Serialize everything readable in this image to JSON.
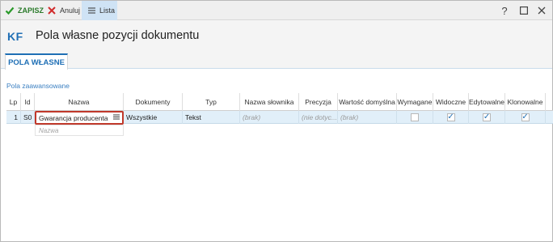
{
  "toolbar": {
    "save_label": "ZAPISZ",
    "cancel_label": "Anuluj",
    "list_label": "Lista",
    "save_icon": "checkmark-icon",
    "cancel_icon": "x-icon",
    "list_icon": "menu-icon"
  },
  "window_controls": {
    "help": "?",
    "maximize": "☐",
    "close": "✕"
  },
  "header": {
    "badge": "KF",
    "title": "Pola własne pozycji dokumentu"
  },
  "tabs": [
    {
      "label": "POLA WŁASNE",
      "active": true
    }
  ],
  "section": {
    "label": "Pola zaawansowane"
  },
  "grid": {
    "columns": [
      "Lp",
      "Id",
      "Nazwa",
      "Dokumenty",
      "Typ",
      "Nazwa słownika",
      "Precyzja",
      "Wartość domyślna",
      "Wymagane",
      "Widoczne",
      "Edytowalne",
      "Klonowalne"
    ],
    "rows": [
      {
        "lp": "1",
        "id": "S0",
        "nazwa": "Gwarancja producenta",
        "dokumenty": "Wszystkie",
        "typ": "Tekst",
        "nazwa_slownika": "(brak)",
        "precyzja": "(nie dotyc...",
        "wartosc_domyslna": "(brak)",
        "wymagane": false,
        "widoczne": true,
        "edytowalne": true,
        "klonowalne": true
      }
    ],
    "new_row_placeholder": "Nazwa"
  },
  "colors": {
    "accent": "#1f6fb5",
    "selection": "#e1eff9",
    "edit_border": "#c0392b",
    "save_green": "#2a7a2a"
  }
}
